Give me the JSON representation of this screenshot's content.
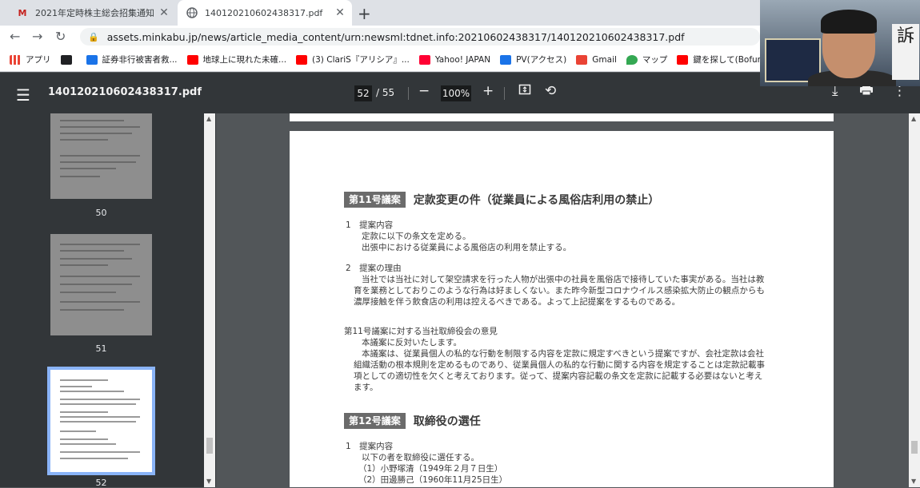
{
  "tabs": [
    {
      "favicon": "M",
      "title": "2021年定時株主総会招集通知 投",
      "close": "✕"
    },
    {
      "favicon": "globe",
      "title": "140120210602438317.pdf",
      "close": "✕"
    }
  ],
  "new_tab": "+",
  "address": {
    "url": "assets.minkabu.jp/news/article_media_content/urn:newsml:tdnet.info:20210602438317/140120210602438317.pdf"
  },
  "bookmarks": [
    {
      "label": "アプリ",
      "icon": "apps-icon",
      "color": "#ea4335"
    },
    {
      "label": "",
      "icon": "bookmark-icon",
      "color": "#202124"
    },
    {
      "label": "証券非行被害者救...",
      "icon": "blue-square-icon",
      "color": "#1a73e8"
    },
    {
      "label": "地球上に現れた未確...",
      "icon": "youtube-icon",
      "color": "#ff0000"
    },
    {
      "label": "(3) ClariS『アリシア』...",
      "icon": "youtube-icon",
      "color": "#ff0000"
    },
    {
      "label": "Yahoo! JAPAN",
      "icon": "yahoo-icon",
      "color": "#ff0033"
    },
    {
      "label": "PV(アクセス)",
      "icon": "blue-square-icon",
      "color": "#1a73e8"
    },
    {
      "label": "Gmail",
      "icon": "gmail-icon",
      "color": "#ea4335"
    },
    {
      "label": "マップ",
      "icon": "maps-icon",
      "color": "#34a853"
    },
    {
      "label": "鍵を探して(Bofura Pr...",
      "icon": "youtube-icon",
      "color": "#ff0000"
    }
  ],
  "pdf_toolbar": {
    "title": "140120210602438317.pdf",
    "current_page": "52",
    "total_pages": "/ 55",
    "zoom": "100%"
  },
  "thumbnails": [
    {
      "label": "50"
    },
    {
      "label": "51"
    },
    {
      "label": "52"
    }
  ],
  "document": {
    "agenda11": {
      "tag": "第11号議案",
      "title": "定款変更の件（従業員による風俗店利用の禁止）",
      "lines": [
        "1　提案内容",
        "定款に以下の条文を定める。",
        "出張中における従業員による風俗店の利用を禁止する。",
        "2　提案の理由",
        "当社では当社に対して架空請求を行った人物が出張中の社員を風俗店で接待していた事実がある。当社は教",
        "育を業務としておりこのような行為は好ましくない。また昨今新型コロナウイルス感染拡大防止の観点からも",
        "濃厚接触を伴う飲食店の利用は控えるべきである。よって上記提案をするものである。",
        "第11号議案に対する当社取締役会の意見",
        "本議案に反対いたします。",
        "本議案は、従業員個人の私的な行動を制限する内容を定款に規定すべきという提案ですが、会社定款は会社",
        "組織活動の根本規則を定めるものであり、従業員個人の私的な行動に関する内容を規定することは定款記載事",
        "項としての適切性を欠くと考えております。従って、提案内容記載の条文を定款に記載する必要はないと考え",
        "ます。"
      ]
    },
    "agenda12": {
      "tag": "第12号議案",
      "title": "取締役の選任",
      "lines": [
        "1　提案内容",
        "以下の者を取締役に選任する。",
        "（1）小野塚清（1949年２月７日生）",
        "（2）田邊勝己（1960年11月25日生）"
      ]
    }
  },
  "webcam": {
    "sign_text": "訴"
  }
}
